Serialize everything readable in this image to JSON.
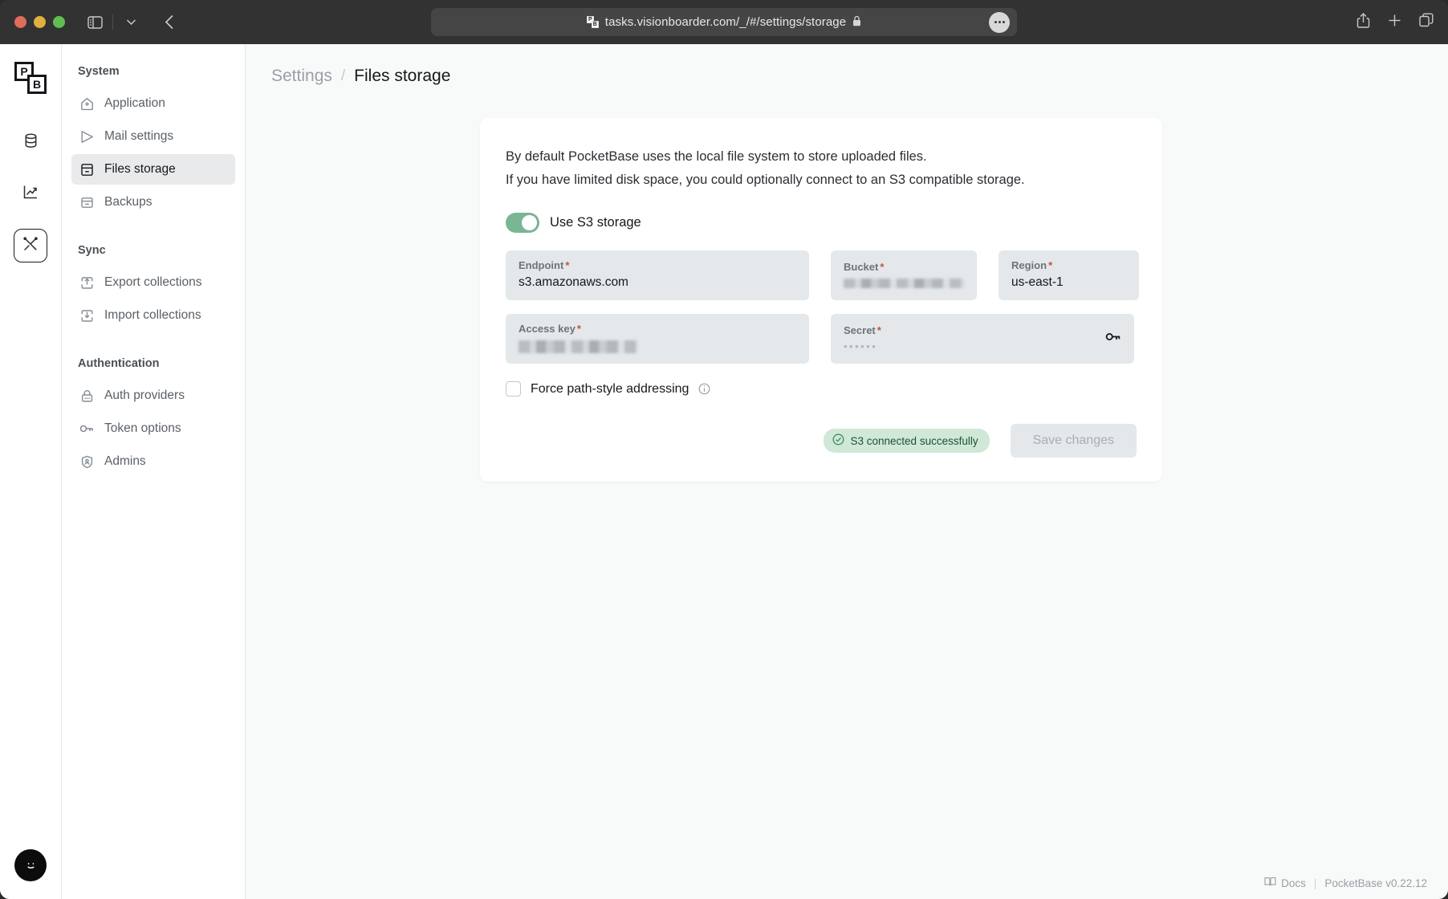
{
  "browser": {
    "url": "tasks.visionboarder.com/_/#/settings/storage",
    "favicon_name": "pocketbase-favicon",
    "lock_icon": "lock-icon",
    "sidebar_toggle_icon": "sidebar-toggle-icon",
    "chevron_icon": "chevron-down-icon",
    "back_icon": "back-arrow-icon",
    "more_icon": "more-options-icon",
    "share_icon": "share-icon",
    "new_tab_icon": "plus-icon",
    "tabs_icon": "tab-overview-icon"
  },
  "rail": {
    "logo": "pocketbase-logo",
    "items": [
      {
        "name": "collections",
        "icon": "database-icon",
        "active": false
      },
      {
        "name": "logs",
        "icon": "chart-line-icon",
        "active": false
      },
      {
        "name": "settings",
        "icon": "tools-icon",
        "active": true
      }
    ],
    "avatar": "admin-avatar"
  },
  "sidebar": {
    "groups": [
      {
        "title": "System",
        "items": [
          {
            "label": "Application",
            "icon": "home-icon",
            "active": false
          },
          {
            "label": "Mail settings",
            "icon": "send-icon",
            "active": false
          },
          {
            "label": "Files storage",
            "icon": "archive-icon",
            "active": true
          },
          {
            "label": "Backups",
            "icon": "backup-icon",
            "active": false
          }
        ]
      },
      {
        "title": "Sync",
        "items": [
          {
            "label": "Export collections",
            "icon": "export-icon",
            "active": false
          },
          {
            "label": "Import collections",
            "icon": "import-icon",
            "active": false
          }
        ]
      },
      {
        "title": "Authentication",
        "items": [
          {
            "label": "Auth providers",
            "icon": "lock-icon",
            "active": false
          },
          {
            "label": "Token options",
            "icon": "key-icon",
            "active": false
          },
          {
            "label": "Admins",
            "icon": "shield-user-icon",
            "active": false
          }
        ]
      }
    ]
  },
  "breadcrumb": {
    "parent": "Settings",
    "separator": "/",
    "current": "Files storage"
  },
  "card": {
    "intro_line1": "By default PocketBase uses the local file system to store uploaded files.",
    "intro_line2": "If you have limited disk space, you could optionally connect to an S3 compatible storage.",
    "toggle": {
      "label": "Use S3 storage",
      "enabled": true
    },
    "fields": {
      "endpoint": {
        "label": "Endpoint",
        "required": "*",
        "value": "s3.amazonaws.com"
      },
      "bucket": {
        "label": "Bucket",
        "required": "*",
        "value": "",
        "redacted": true
      },
      "region": {
        "label": "Region",
        "required": "*",
        "value": "us-east-1"
      },
      "access_key": {
        "label": "Access key",
        "required": "*",
        "value": "",
        "redacted": true
      },
      "secret": {
        "label": "Secret",
        "required": "*",
        "value": "••••••",
        "reveal_icon": "key-icon"
      }
    },
    "checkbox": {
      "label": "Force path-style addressing",
      "checked": false,
      "info_icon": "info-icon"
    },
    "status": {
      "text": "S3 connected successfully",
      "icon": "check-circle-icon",
      "color": "#cfe8d7"
    },
    "save_label": "Save changes"
  },
  "footer": {
    "docs_label": "Docs",
    "docs_icon": "book-icon",
    "separator": "|",
    "version": "PocketBase v0.22.12"
  }
}
